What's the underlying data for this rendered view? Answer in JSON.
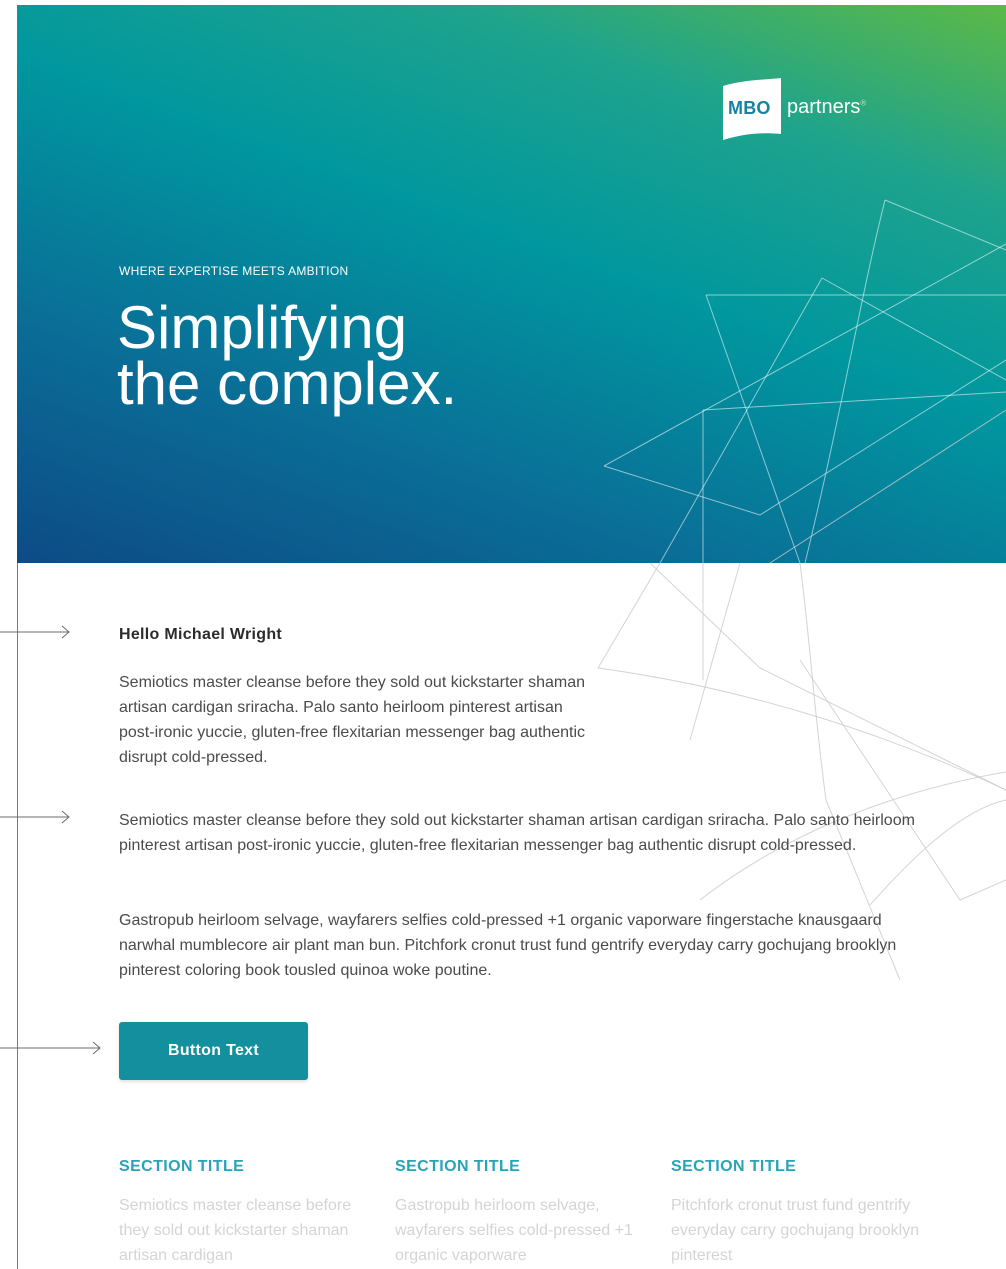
{
  "brand": {
    "logo_mbo": "MBO",
    "logo_partners": "partners",
    "logo_mark": "®"
  },
  "hero": {
    "eyebrow": "WHERE EXPERTISE MEETS AMBITION",
    "headline_line1": "Simplifying",
    "headline_line2": "the complex.",
    "gradient_colors": [
      "#5cb947",
      "#1ea38d",
      "#00979f",
      "#0a6f97",
      "#0d4b86"
    ]
  },
  "content": {
    "greeting": "Hello Michael Wright",
    "paragraph1": "Semiotics master cleanse before they sold out kickstarter shaman artisan cardigan sriracha. Palo santo heirloom pinterest artisan post-ironic yuccie, gluten-free flexitarian messenger bag authentic disrupt cold-pressed.",
    "paragraph2": "Semiotics master cleanse before they sold out kickstarter shaman artisan cardigan sriracha. Palo santo heirloom pinterest artisan post-ironic yuccie, gluten-free flexitarian messenger bag authentic disrupt cold-pressed.",
    "paragraph3": "Gastropub heirloom selvage, wayfarers selfies cold-pressed +1 organic vaporware fingerstache knausgaard narwhal mumblecore air plant man bun. Pitchfork cronut trust fund gentrify everyday carry gochujang brooklyn pinterest coloring book tousled quinoa woke poutine.",
    "button_label": "Button Text",
    "button_color": "#138f9d"
  },
  "sections": [
    {
      "title": "SECTION TITLE",
      "text": "Semiotics master cleanse before they sold out kickstarter shaman artisan cardigan"
    },
    {
      "title": "SECTION TITLE",
      "text": "Gastropub heirloom selvage, wayfarers selfies cold-pressed +1 organic vaporware"
    },
    {
      "title": "SECTION TITLE",
      "text": "Pitchfork cronut trust fund gentrify everyday carry gochujang brooklyn pinterest"
    }
  ],
  "accent_color": "#2aa3b7"
}
